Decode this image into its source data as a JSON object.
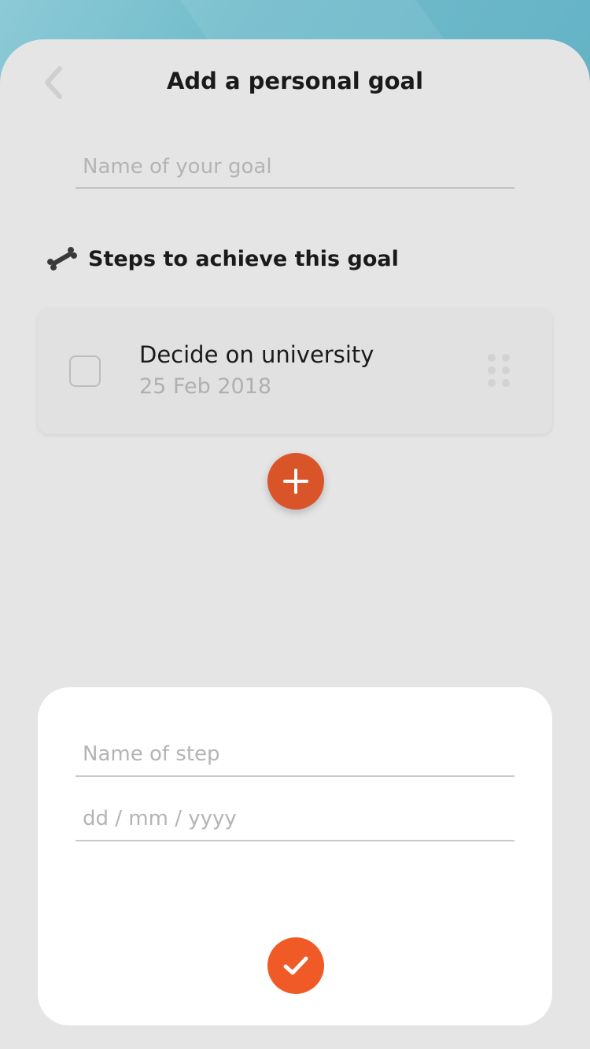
{
  "header": {
    "title": "Add a personal goal",
    "back_icon": "chevron-left-icon"
  },
  "goal_form": {
    "name_placeholder": "Name of your goal",
    "name_value": ""
  },
  "steps_section": {
    "icon": "bone-icon",
    "label": "Steps to achieve this goal",
    "steps": [
      {
        "name": "Decide on university",
        "date": "25 Feb 2018",
        "checked": false
      }
    ],
    "add_icon": "plus-icon"
  },
  "step_form": {
    "name_placeholder": "Name of step",
    "date_placeholder": "dd / mm / yyyy",
    "confirm_icon": "checkmark-icon"
  },
  "colors": {
    "accent": "#ef5a26",
    "add_button": "#d95428",
    "sheet_background": "#e5e5e5",
    "top_background": "#6cb8c9"
  }
}
